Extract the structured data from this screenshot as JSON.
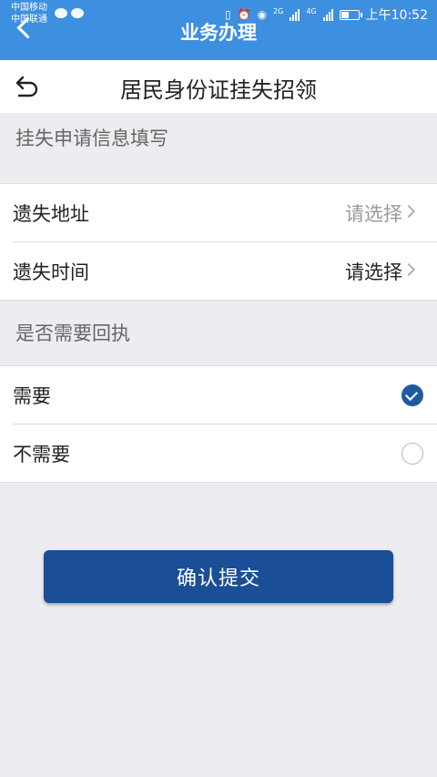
{
  "status_bar": {
    "carrier1": "中国移动",
    "carrier2": "中国联通",
    "net_a": "2G",
    "net_b": "4G",
    "time": "上午10:52"
  },
  "app_bar": {
    "title": "业务办理"
  },
  "page": {
    "title": "居民身份证挂失招领"
  },
  "form": {
    "section1_label": "挂失申请信息填写",
    "loss_address": {
      "label": "遗失地址",
      "value": "请选择",
      "value_color": "#999999"
    },
    "loss_time": {
      "label": "遗失时间",
      "value": "请选择",
      "value_color": "#222222"
    },
    "section2_label": "是否需要回执",
    "receipt_options": [
      {
        "label": "需要",
        "selected": true
      },
      {
        "label": "不需要",
        "selected": false
      }
    ]
  },
  "submit_label": "确认提交",
  "colors": {
    "app_bar": "#3d8fe0",
    "button": "#1a4e96",
    "radio_selected": "#1e5aa0"
  }
}
